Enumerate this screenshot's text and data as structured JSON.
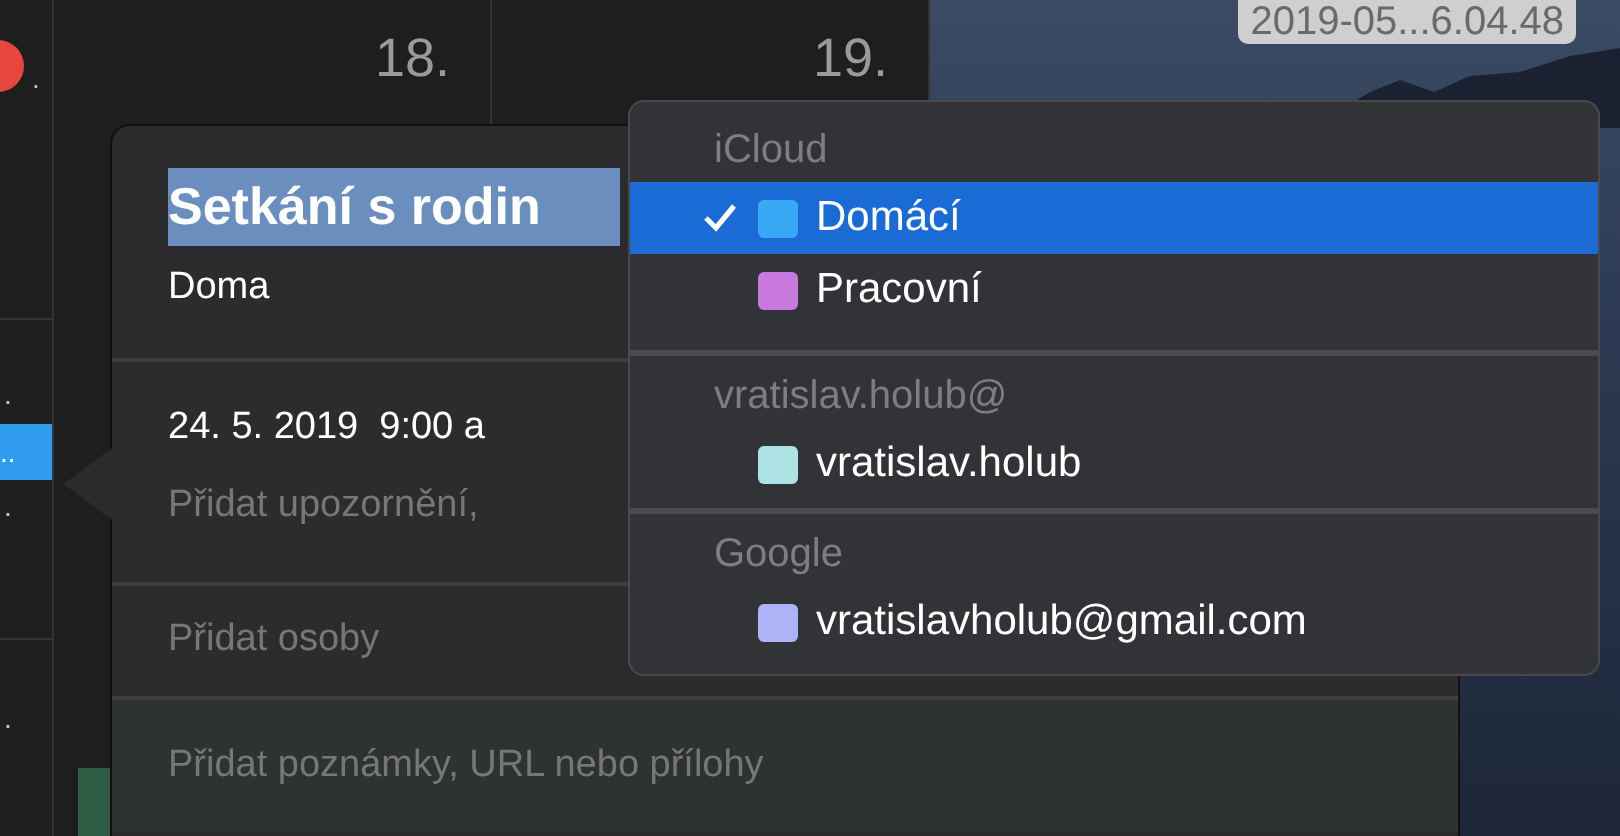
{
  "calendar": {
    "today_suffix": ".",
    "days": [
      "18.",
      "19."
    ],
    "left_marks": [
      ".",
      ".",
      "."
    ],
    "selected_event": {
      "label": "..",
      "selected": true
    }
  },
  "desktop": {
    "file_label": "2019-05...6.04.48"
  },
  "event_popover": {
    "title": "Setkání s rodin",
    "title_selected": true,
    "location": "Doma",
    "date_time": "24. 5. 2019  9:00 a",
    "alert_placeholder": "Přidat upozornění,",
    "invitees_placeholder": "Přidat osoby",
    "notes_placeholder": "Přidat poznámky, URL nebo přílohy"
  },
  "calendar_menu": {
    "groups": [
      {
        "header": "iCloud",
        "items": [
          {
            "label": "Domácí",
            "color": "#3aa9f5",
            "selected": true
          },
          {
            "label": "Pracovní",
            "color": "#c879dd",
            "selected": false
          }
        ]
      },
      {
        "header": "vratislav.holub@",
        "items": [
          {
            "label": "vratislav.holub",
            "color": "#aee3e6",
            "selected": false
          }
        ]
      },
      {
        "header": "Google",
        "items": [
          {
            "label": "vratislavholub@gmail.com",
            "color": "#aeb2f7",
            "selected": false
          }
        ]
      }
    ]
  }
}
